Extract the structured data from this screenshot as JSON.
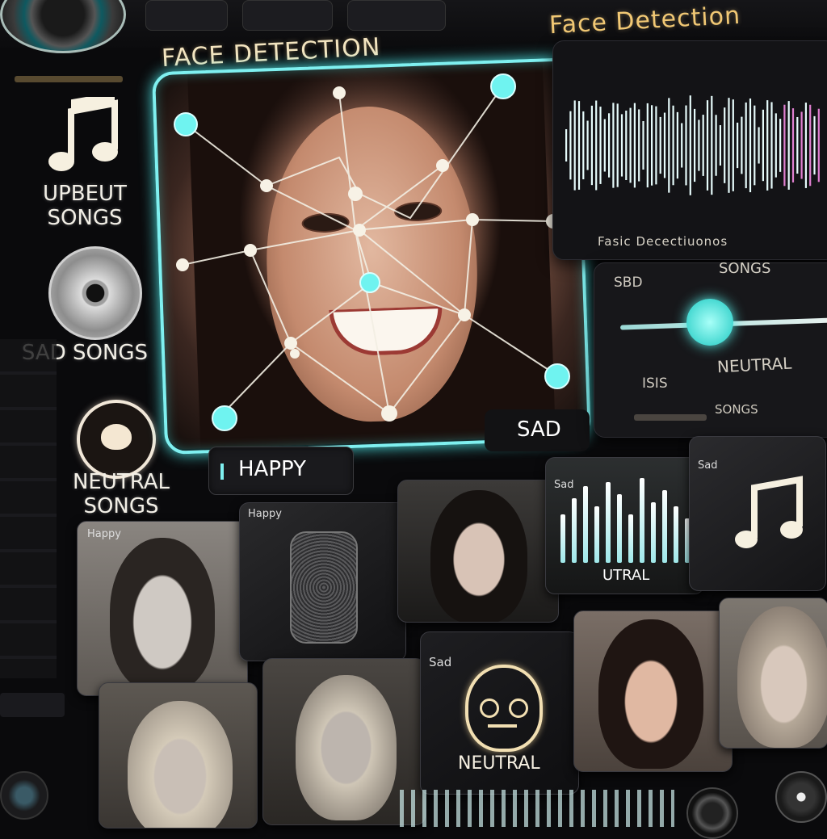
{
  "header": {
    "title": "FACE DETECTION",
    "right_title": "Face Detection"
  },
  "sidebar": {
    "caption": "",
    "items": [
      {
        "label": "UPBEUT SONGS",
        "icon": "music-note-icon"
      },
      {
        "label": "SAD SONGS",
        "icon": "disc-icon"
      },
      {
        "label": "NEUTRAL SONGS",
        "icon": "heart-icon"
      }
    ]
  },
  "detection": {
    "happy_label": "HAPPY",
    "sad_label": "SAD"
  },
  "right_panel": {
    "caption": "Fasic Decectiuonos",
    "songs_label": "SONGS",
    "left_value": "SBD",
    "left_value2": "ISIS",
    "neutral_label": "NEUTRAL",
    "footer_label": "SONGS",
    "slider_value": 0.5
  },
  "tiles": {
    "row1": [
      {
        "label": "Happy",
        "type": "face-dark"
      },
      {
        "label": "Happy",
        "type": "microphone"
      },
      {
        "label": "",
        "type": "face-woman"
      },
      {
        "label": "Sad",
        "caption": "UTRAL",
        "type": "waveform"
      },
      {
        "label": "Sad",
        "type": "music-note"
      }
    ],
    "row2": [
      {
        "label": "",
        "type": "face-blonde"
      },
      {
        "label": "",
        "type": "face-blonde-closed"
      },
      {
        "label": "Sad",
        "caption": "NEUTRAL",
        "type": "neutral-face-icon"
      },
      {
        "label": "",
        "type": "face-brunette"
      },
      {
        "label": "",
        "type": "face-light"
      }
    ]
  },
  "colors": {
    "accent_cyan": "#7ff0f0",
    "title_gold": "#f3c064",
    "background": "#0a0a0c"
  }
}
